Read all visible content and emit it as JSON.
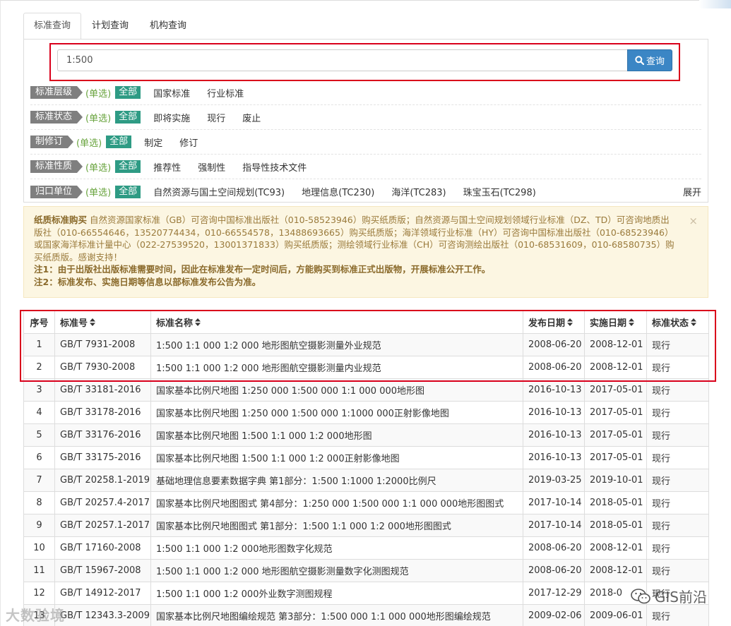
{
  "tabs": [
    "标准查询",
    "计划查询",
    "机构查询"
  ],
  "search": {
    "value": "1:500",
    "button_label": "查询"
  },
  "filters": [
    {
      "label": "标准层级",
      "single": "(单选)",
      "all": "全部",
      "options": [
        "国家标准",
        "行业标准"
      ]
    },
    {
      "label": "标准状态",
      "single": "(单选)",
      "all": "全部",
      "options": [
        "即将实施",
        "现行",
        "废止"
      ]
    },
    {
      "label": "制修订",
      "single": "(单选)",
      "all": "全部",
      "options": [
        "制定",
        "修订"
      ]
    },
    {
      "label": "标准性质",
      "single": "(单选)",
      "all": "全部",
      "options": [
        "推荐性",
        "强制性",
        "指导性技术文件"
      ]
    },
    {
      "label": "归口单位",
      "single": "(单选)",
      "all": "全部",
      "options": [
        "自然资源与国土空间规划(TC93)",
        "地理信息(TC230)",
        "海洋(TC283)",
        "珠宝玉石(TC298)"
      ],
      "expand": "展开"
    }
  ],
  "notice": {
    "title": "纸质标准购买",
    "body": "自然资源国家标准（GB）可咨询中国标准出版社（010-58523946）购买纸质版；自然资源与国土空间规划领域行业标准（DZ、TD）可咨询地质出版社（010-66554646，13520774434，010-66554578，13488693665）购买纸质版；海洋领域行业标准（HY）可咨询中国标准出版社（010-68523946）或国家海洋标准计量中心（022-27539520，13001371833）购买纸质版；测绘领域行业标准（CH）可咨询测绘出版社（010-68531609，010-68580735）购买纸质版。感谢支持！",
    "note1": "注1：由于出版社出版标准需要时间，因此在标准发布一定时间后，方能购买到标准正式出版物，开展标准公开工作。",
    "note2": "注2：标准发布、实施日期等信息以部标准发布公告为准。",
    "close": "×"
  },
  "table": {
    "headers": [
      "序号",
      "标准号",
      "标准名称",
      "发布日期",
      "实施日期",
      "标准状态"
    ],
    "rows": [
      [
        "1",
        "GB/T 7931-2008",
        "1:500 1:1 000 1:2 000 地形图航空摄影测量外业规范",
        "2008-06-20",
        "2008-12-01",
        "现行"
      ],
      [
        "2",
        "GB/T 7930-2008",
        "1:500 1:1 000 1:2 000 地形图航空摄影测量内业规范",
        "2008-06-20",
        "2008-12-01",
        "现行"
      ],
      [
        "3",
        "GB/T 33181-2016",
        "国家基本比例尺地图 1:250 000 1:500 000 1:1 000 000地形图",
        "2016-10-13",
        "2017-05-01",
        "现行"
      ],
      [
        "4",
        "GB/T 33178-2016",
        "国家基本比例尺地图 1:250 000 1:500 000 1:1000 000正射影像地图",
        "2016-10-13",
        "2017-05-01",
        "现行"
      ],
      [
        "5",
        "GB/T 33176-2016",
        "国家基本比例尺地图 1:500 1:1 000 1:2 000地形图",
        "2016-10-13",
        "2017-05-01",
        "现行"
      ],
      [
        "6",
        "GB/T 33175-2016",
        "国家基本比例尺地图 1:500 1:1 000 1:2 000正射影像地图",
        "2016-10-13",
        "2017-05-01",
        "现行"
      ],
      [
        "7",
        "GB/T 20258.1-2019",
        "基础地理信息要素数据字典 第1部分：1:500 1:1000 1:2000比例尺",
        "2019-03-25",
        "2019-10-01",
        "现行"
      ],
      [
        "8",
        "GB/T 20257.4-2017",
        "国家基本比例尺地图图式 第4部分：1:250 000 1:500 000 1:1 000 000地形图图式",
        "2017-10-14",
        "2018-05-01",
        "现行"
      ],
      [
        "9",
        "GB/T 20257.1-2017",
        "国家基本比例尺地图图式 第1部分：1:500 1:1 000 1:2 000地形图图式",
        "2017-10-14",
        "2018-05-01",
        "现行"
      ],
      [
        "10",
        "GB/T 17160-2008",
        "1:500 1:1 000 1:2 000地形图数字化规范",
        "2008-06-20",
        "2008-12-01",
        "现行"
      ],
      [
        "11",
        "GB/T 15967-2008",
        "1:500 1:1 000 1:2 000 地形图航空摄影测量数字化测图规范",
        "2008-06-20",
        "2008-12-01",
        "现行"
      ],
      [
        "12",
        "GB/T 14912-2017",
        "1:500 1:1 000 1:2 000外业数字测图规程",
        "2017-12-29",
        "2018-0",
        "现行"
      ],
      [
        "13",
        "GB/T 12343.3-2009",
        "国家基本比例尺地图编绘规范 第3部分：1:500 000 1:1 000 000地形图编绘规范",
        "2009-02-06",
        "2009-06-01",
        "现行"
      ]
    ]
  },
  "watermarks": {
    "left": "大数验境",
    "right": "GIS前沿"
  }
}
